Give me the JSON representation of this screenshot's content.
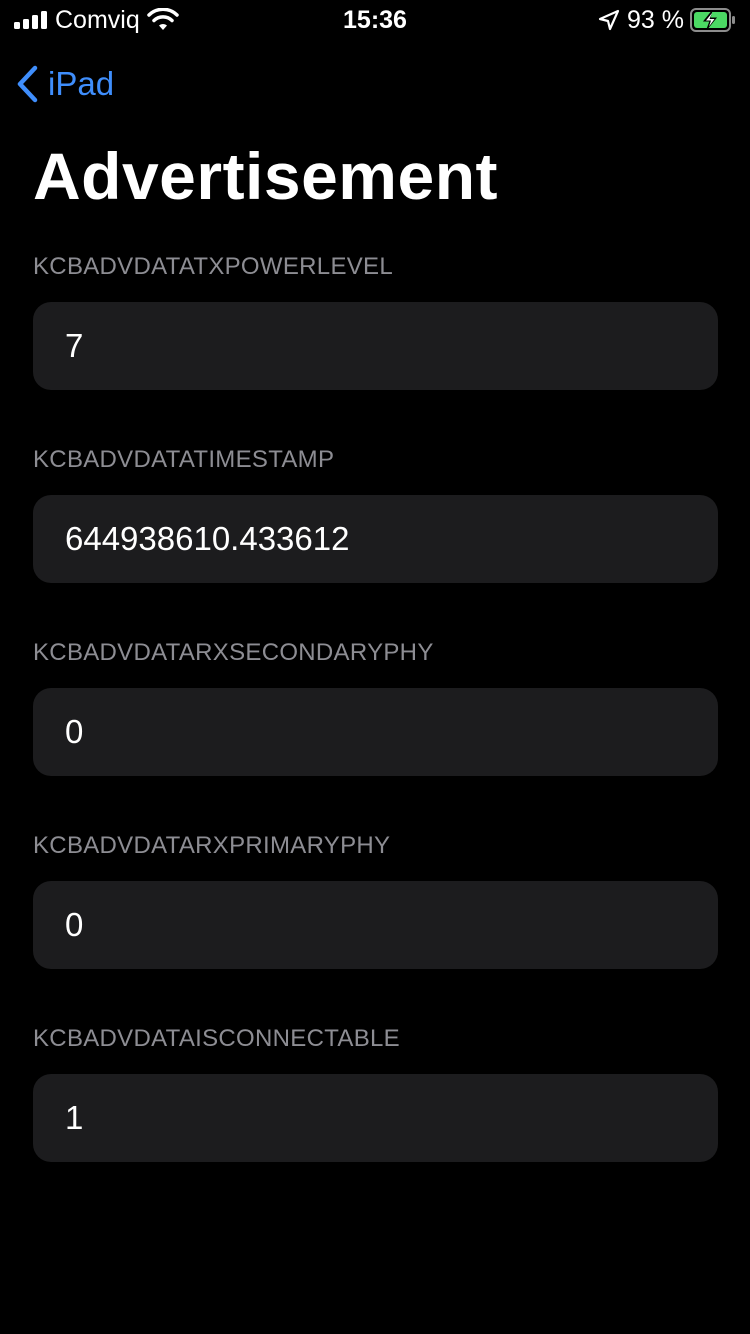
{
  "status_bar": {
    "carrier": "Comviq",
    "time": "15:36",
    "battery_percent": "93 %",
    "icons": [
      "signal-icon",
      "wifi-icon",
      "location-icon",
      "battery-charging-icon"
    ],
    "battery_color": "#4cd964"
  },
  "nav": {
    "back_label": "iPad",
    "accent_color": "#3f8efc"
  },
  "page": {
    "title": "Advertisement"
  },
  "fields": [
    {
      "label": "KCBADVDATATXPOWERLEVEL",
      "value": "7"
    },
    {
      "label": "KCBADVDATATIMESTAMP",
      "value": "644938610.433612"
    },
    {
      "label": "KCBADVDATARXSECONDARYPHY",
      "value": "0"
    },
    {
      "label": "KCBADVDATARXPRIMARYPHY",
      "value": "0"
    },
    {
      "label": "KCBADVDATAISCONNECTABLE",
      "value": "1"
    }
  ]
}
